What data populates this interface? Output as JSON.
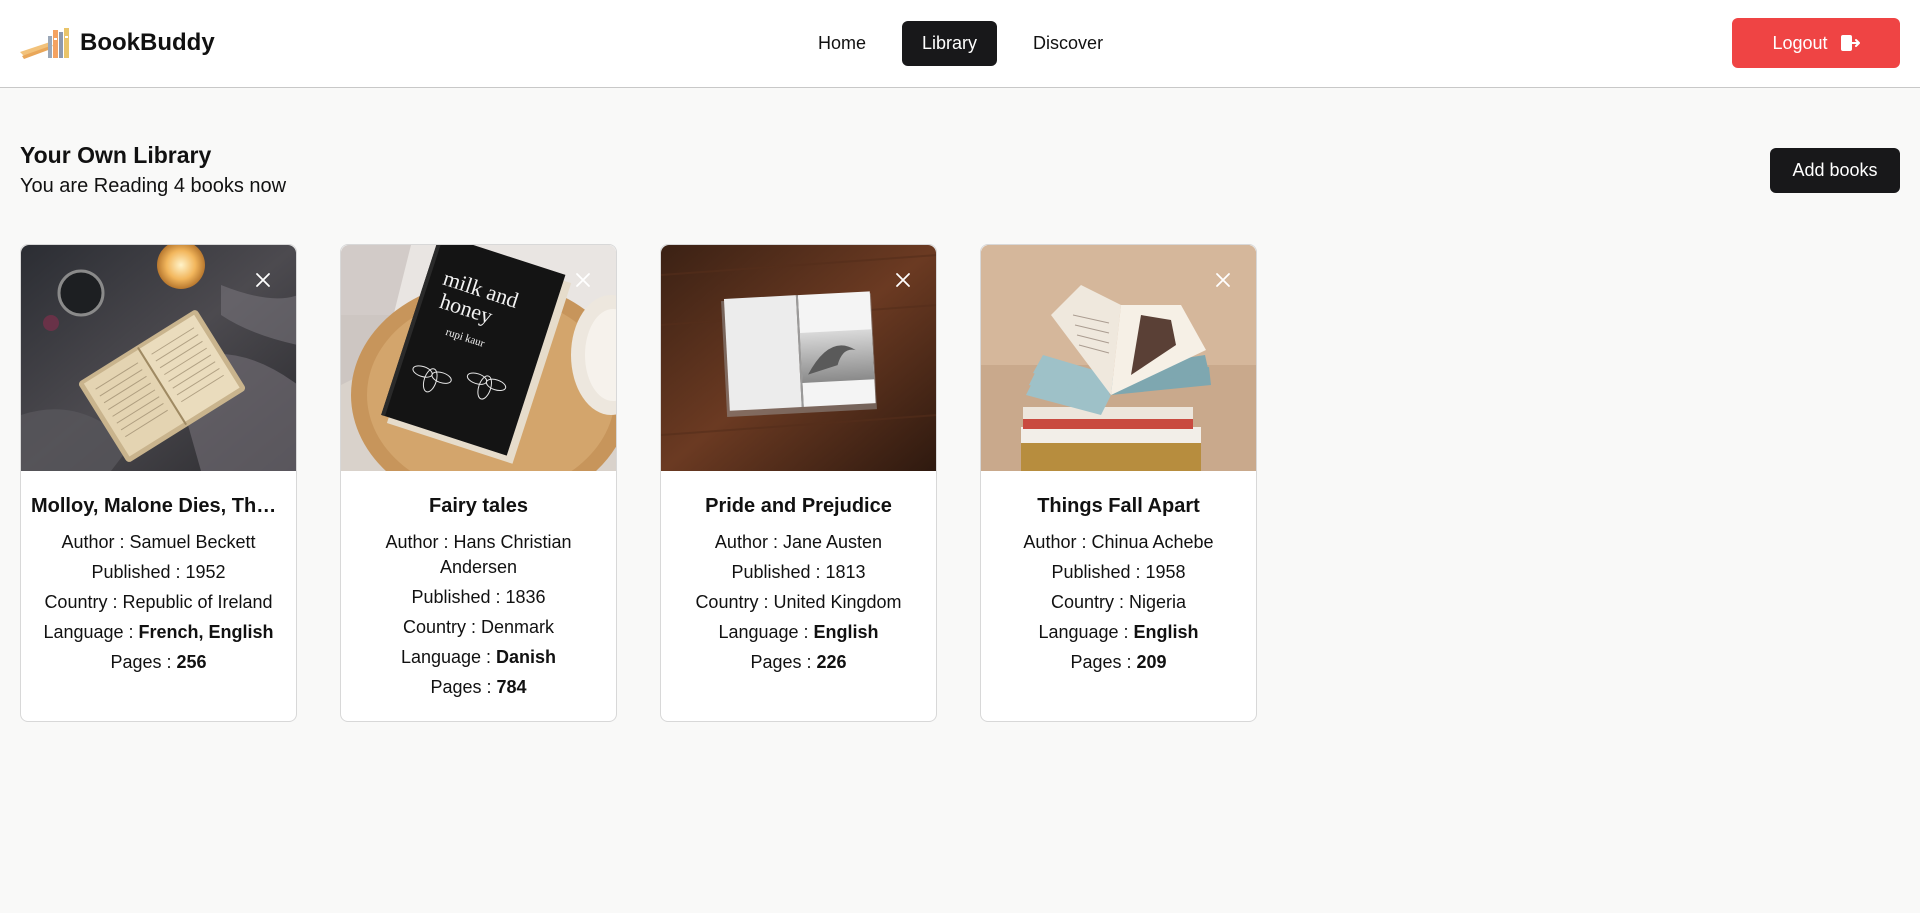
{
  "app": {
    "name": "BookBuddy",
    "logo_icon": "books-icon"
  },
  "nav": {
    "items": [
      {
        "label": "Home",
        "active": false
      },
      {
        "label": "Library",
        "active": true
      },
      {
        "label": "Discover",
        "active": false
      }
    ],
    "logout_label": "Logout",
    "logout_icon": "logout-icon"
  },
  "library": {
    "title": "Your Own Library",
    "subtitle": "You are Reading 4 books now",
    "add_label": "Add books"
  },
  "colors": {
    "accent_dark": "#18181a",
    "logout_red": "#ef4444",
    "page_bg": "#f9f9f8"
  },
  "labels": {
    "author": "Author : ",
    "published": "Published : ",
    "country": "Country : ",
    "language": "Language : ",
    "pages": "Pages : "
  },
  "books": [
    {
      "title": "Molloy, Malone Dies, The Unnamable, the trilogy",
      "author": "Samuel Beckett",
      "published": "1952",
      "country": "Republic of Ireland",
      "language": "French, English",
      "pages": "256",
      "cover": "open-book-blanket-photo"
    },
    {
      "title": "Fairy tales",
      "author": "Hans Christian Andersen",
      "published": "1836",
      "country": "Denmark",
      "language": "Danish",
      "pages": "784",
      "cover": "milk-and-honey-book-photo",
      "cover_text": {
        "title": "milk and honey",
        "author": "rupi kaur"
      }
    },
    {
      "title": "Pride and Prejudice",
      "author": "Jane Austen",
      "published": "1813",
      "country": "United Kingdom",
      "language": "English",
      "pages": "226",
      "cover": "open-book-wood-table-photo"
    },
    {
      "title": "Things Fall Apart",
      "author": "Chinua Achebe",
      "published": "1958",
      "country": "Nigeria",
      "language": "English",
      "pages": "209",
      "cover": "stacked-books-photo"
    }
  ]
}
